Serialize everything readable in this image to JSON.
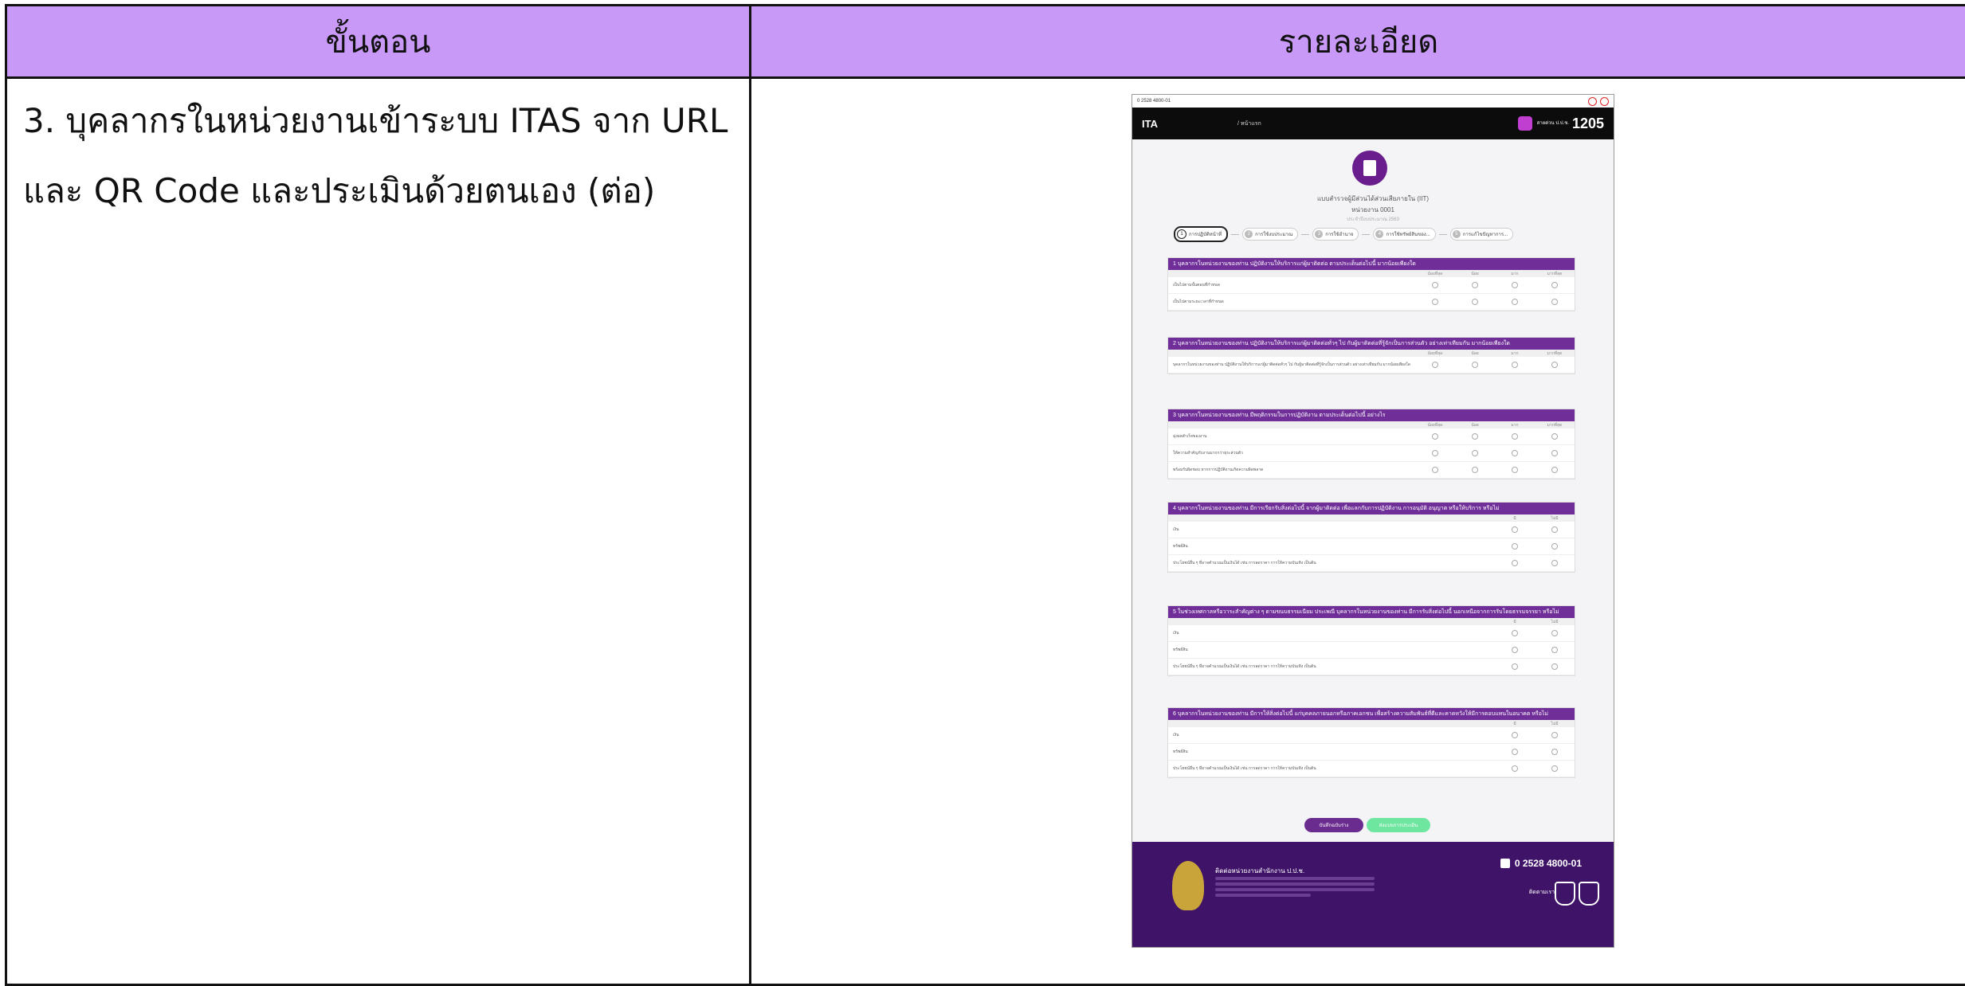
{
  "table": {
    "header_left": "ขั้นตอน",
    "header_right": "รายละเอียด",
    "step_text": "3. บุคลากรในหน่วยงานเข้าระบบ ITAS จาก URL และ QR Code และประเมินด้วยตนเอง (ต่อ)"
  },
  "colors": {
    "header_bg": "#c999f7",
    "nav_bg": "#0c0c0c",
    "purple": "#6f2e98",
    "footer_bg": "#3f1468"
  },
  "screenshot": {
    "top_phone": "0 2528 4800-01",
    "nav_logo": "ITA",
    "nav_crumb": "/ หน้าแรก",
    "hotline_label": "สายด่วน ป.ป.ช.",
    "hotline_number": "1205",
    "form_title": "แบบสำรวจผู้มีส่วนได้ส่วนเสียภายใน (IIT)",
    "form_unit": "หน่วยงาน 0001",
    "form_year": "ประจำปีงบประมาณ 2563",
    "steps": [
      "การปฏิบัติหน้าที่",
      "การใช้งบประมาณ",
      "การใช้อำนาจ",
      "การใช้ทรัพย์สินของ...",
      "การแก้ไขปัญหาการ..."
    ],
    "questions": [
      {
        "title": "1 บุคลากรในหน่วยงานของท่าน ปฏิบัติงานให้บริการแก่ผู้มาติดต่อ ตามประเด็นต่อไปนี้ มากน้อยเพียงใด",
        "cols": [
          "น้อยที่สุด",
          "น้อย",
          "มาก",
          "มากที่สุด"
        ],
        "rows": [
          "เป็นไปตามขั้นตอนที่กำหนด",
          "เป็นไปตามระยะเวลาที่กำหนด"
        ]
      },
      {
        "title": "2 บุคลากรในหน่วยงานของท่าน ปฏิบัติงานให้บริการแก่ผู้มาติดต่อทั่วๆ ไป กับผู้มาติดต่อที่รู้จักเป็นการส่วนตัว อย่างเท่าเทียมกัน มากน้อยเพียงใด",
        "cols": [
          "น้อยที่สุด",
          "น้อย",
          "มาก",
          "มากที่สุด"
        ],
        "rows": [
          "บุคลากรในหน่วยงานของท่าน ปฏิบัติงานให้บริการแก่ผู้มาติดต่อทั่วๆ ไป กับผู้มาติดต่อที่รู้จักเป็นการส่วนตัว อย่างเท่าเทียมกัน มากน้อยเพียงใด"
        ]
      },
      {
        "title": "3 บุคลากรในหน่วยงานของท่าน มีพฤติกรรมในการปฏิบัติงาน ตามประเด็นต่อไปนี้ อย่างไร",
        "cols": [
          "น้อยที่สุด",
          "น้อย",
          "มาก",
          "มากที่สุด"
        ],
        "rows": [
          "มุ่งผลสำเร็จของงาน",
          "ให้ความสำคัญกับงานมากกว่าธุระส่วนตัว",
          "พร้อมรับผิดชอบ หากการปฏิบัติงานเกิดความผิดพลาด"
        ]
      },
      {
        "title": "4 บุคลากรในหน่วยงานของท่าน มีการเรียกรับสิ่งต่อไปนี้ จากผู้มาติดต่อ เพื่อแลกกับการปฏิบัติงาน การอนุมัติ อนุญาต หรือให้บริการ หรือไม่",
        "cols": [
          "มี",
          "ไม่มี"
        ],
        "rows": [
          "เงิน",
          "ทรัพย์สิน",
          "ประโยชน์อื่น ๆ ที่อาจคำนวณเป็นเงินได้ เช่น การลดราคา การให้ความบันเทิง เป็นต้น"
        ]
      },
      {
        "title": "5 ในช่วงเทศกาลหรือวาระสำคัญต่าง ๆ ตามขนบธรรมเนียม ประเพณี บุคลากรในหน่วยงานของท่าน มีการรับสิ่งต่อไปนี้ นอกเหนือจากการรับโดยธรรมจรรยา หรือไม่",
        "cols": [
          "มี",
          "ไม่มี"
        ],
        "rows": [
          "เงิน",
          "ทรัพย์สิน",
          "ประโยชน์อื่น ๆ ที่อาจคำนวณเป็นเงินได้ เช่น การลดราคา การให้ความบันเทิง เป็นต้น"
        ]
      },
      {
        "title": "6 บุคลากรในหน่วยงานของท่าน มีการให้สิ่งต่อไปนี้ แก่บุคคลภายนอกหรือภาคเอกชน เพื่อสร้างความสัมพันธ์ที่ดีและคาดหวังให้มีการตอบแทนในอนาคต หรือไม่",
        "cols": [
          "มี",
          "ไม่มี"
        ],
        "rows": [
          "เงิน",
          "ทรัพย์สิน",
          "ประโยชน์อื่น ๆ ที่อาจคำนวณเป็นเงินได้ เช่น การลดราคา การให้ความบันเทิง เป็นต้น"
        ]
      }
    ],
    "btn_save": "บันทึกฉบับร่าง",
    "btn_next": "ส่งแบบการประเมิน",
    "footer_title": "ติดต่อหน่วยงานสำนักงาน ป.ป.ช.",
    "footer_phone": "0 2528 4800-01",
    "footer_follow": "ติดตามเรา"
  }
}
